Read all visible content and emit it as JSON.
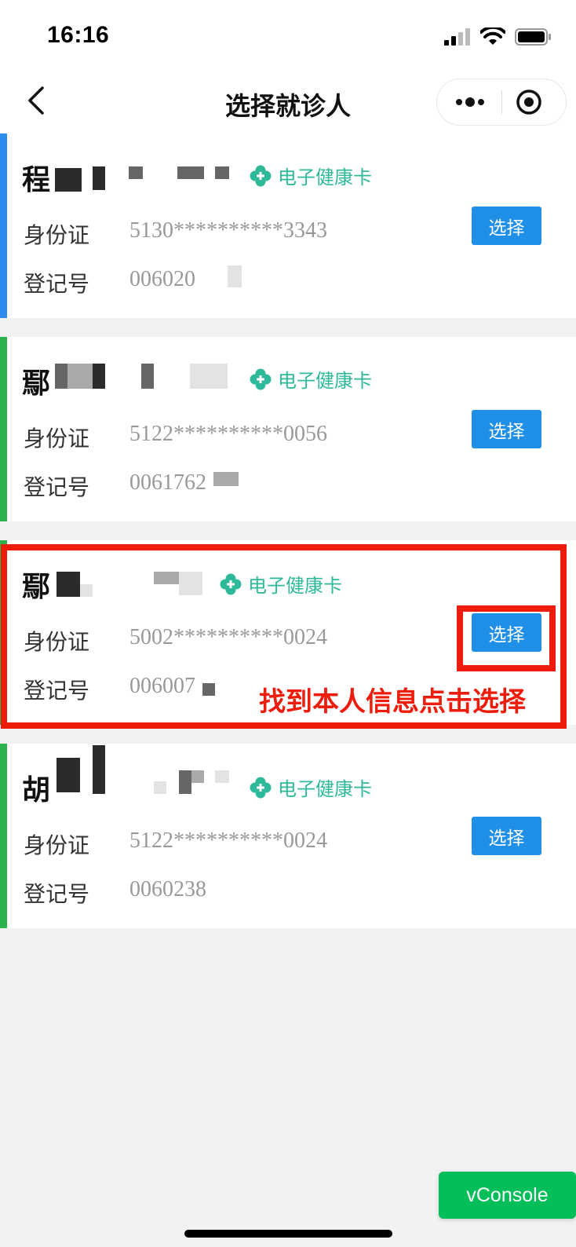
{
  "status_bar": {
    "time": "16:16"
  },
  "nav": {
    "title": "选择就诊人"
  },
  "labels": {
    "id_card": "身份证",
    "register_no": "登记号",
    "ehc": "电子健康卡",
    "select": "选择"
  },
  "patients": [
    {
      "name_visible": "程",
      "id_card": "5130**********3343",
      "register_no": "006020",
      "accent": "#2d8cf0"
    },
    {
      "name_visible": "鄢",
      "id_card": "5122**********0056",
      "register_no": "0061762",
      "accent": "#2bb24c"
    },
    {
      "name_visible": "鄢",
      "id_card": "5002**********0024",
      "register_no": "006007",
      "accent": "#2bb24c"
    },
    {
      "name_visible": "胡",
      "id_card": "5122**********0024",
      "register_no": "0060238",
      "accent": "#2bb24c"
    }
  ],
  "annotation": {
    "text": "找到本人信息点击选择",
    "color": "#ee1c0b"
  },
  "vconsole": {
    "label": "vConsole"
  }
}
